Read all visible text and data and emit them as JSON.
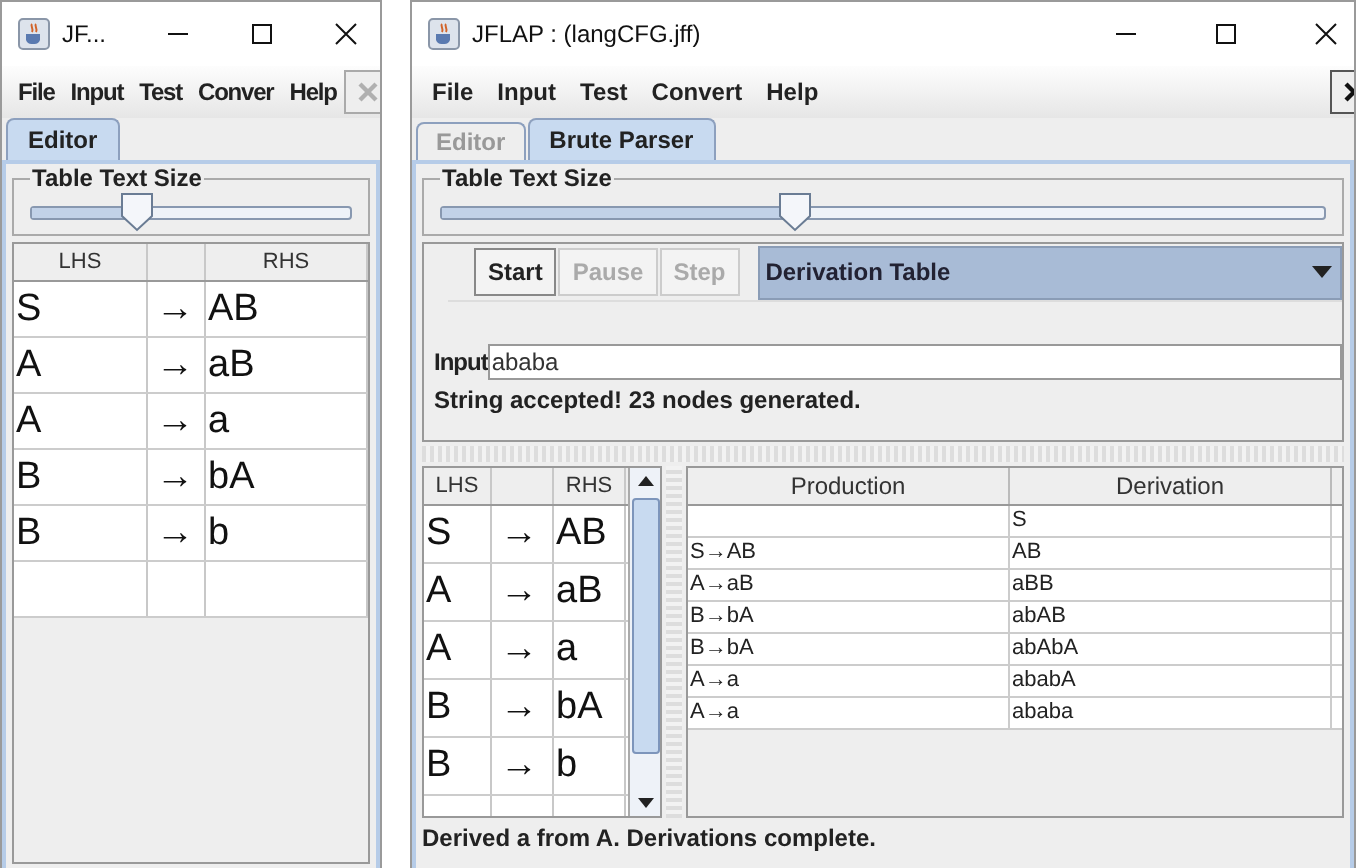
{
  "left_window": {
    "title": "JF...",
    "menu": [
      "File",
      "Input",
      "Test",
      "Conver",
      "Help"
    ],
    "close_button": {
      "disabled": true
    },
    "tabs": [
      {
        "label": "Editor",
        "selected": true
      }
    ],
    "slider": {
      "label": "Table Text Size",
      "level": 0.33
    },
    "grammar": {
      "columns": [
        "LHS",
        "RHS"
      ],
      "rows": [
        {
          "lhs": "S",
          "arrow": "→",
          "rhs": "AB"
        },
        {
          "lhs": "A",
          "arrow": "→",
          "rhs": "aB"
        },
        {
          "lhs": "A",
          "arrow": "→",
          "rhs": "a"
        },
        {
          "lhs": "B",
          "arrow": "→",
          "rhs": "bA"
        },
        {
          "lhs": "B",
          "arrow": "→",
          "rhs": "b"
        }
      ]
    }
  },
  "right_window": {
    "title": "JFLAP : (langCFG.jff)",
    "menu": [
      "File",
      "Input",
      "Test",
      "Convert",
      "Help"
    ],
    "close_button": {
      "disabled": false
    },
    "tabs": [
      {
        "label": "Editor",
        "selected": false
      },
      {
        "label": "Brute Parser",
        "selected": true
      }
    ],
    "slider": {
      "label": "Table Text Size",
      "level": 0.4
    },
    "controls": [
      {
        "label": "Start",
        "disabled": false
      },
      {
        "label": "Pause",
        "disabled": true
      },
      {
        "label": "Step",
        "disabled": true
      }
    ],
    "view_select": "Derivation Table",
    "input": {
      "label": "Input",
      "value": "ababa"
    },
    "message": "String accepted!  23 nodes generated.",
    "grammar": {
      "columns": [
        "LHS",
        "RHS"
      ],
      "rows": [
        {
          "lhs": "S",
          "arrow": "→",
          "rhs": "AB"
        },
        {
          "lhs": "A",
          "arrow": "→",
          "rhs": "aB"
        },
        {
          "lhs": "A",
          "arrow": "→",
          "rhs": "a"
        },
        {
          "lhs": "B",
          "arrow": "→",
          "rhs": "bA"
        },
        {
          "lhs": "B",
          "arrow": "→",
          "rhs": "b"
        }
      ]
    },
    "derivation": {
      "columns": [
        "Production",
        "Derivation"
      ],
      "rows": [
        {
          "production": "",
          "derivation": "S"
        },
        {
          "production": "S→AB",
          "derivation": "AB"
        },
        {
          "production": "A→aB",
          "derivation": "aBB"
        },
        {
          "production": "B→bA",
          "derivation": "abAB"
        },
        {
          "production": "B→bA",
          "derivation": "abAbA"
        },
        {
          "production": "A→a",
          "derivation": "ababA"
        },
        {
          "production": "A→a",
          "derivation": "ababa"
        }
      ]
    },
    "status_bar": "Derived a from A.  Derivations complete."
  }
}
